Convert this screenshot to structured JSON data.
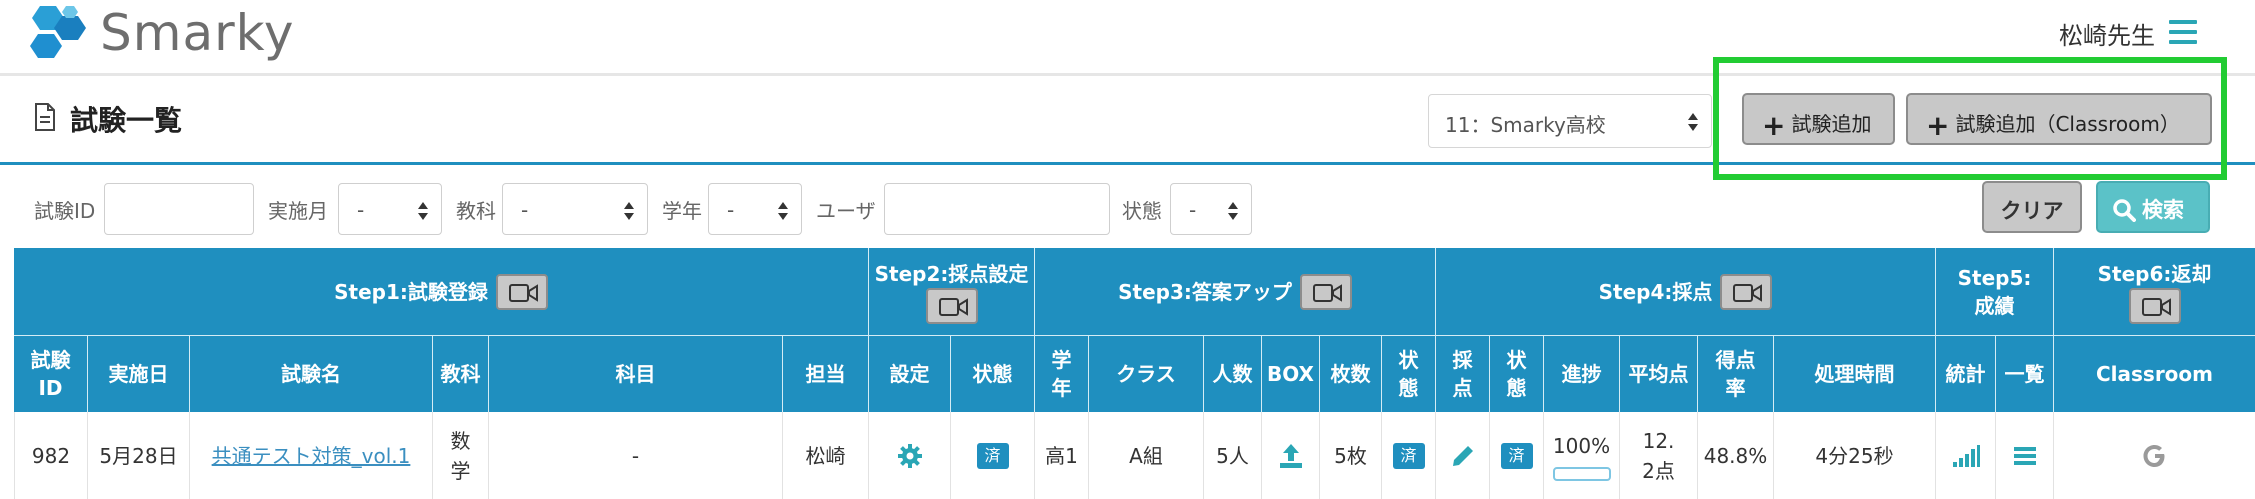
{
  "header": {
    "brand": "Smarky",
    "user": "松崎先生",
    "accent": "#2aa6b5"
  },
  "page": {
    "title": "試験一覧",
    "school_select": "11：Smarky高校",
    "add_exam_label": "試験追加",
    "add_exam_classroom_label": "試験追加（Classroom）",
    "highlight_color": "#22cc33"
  },
  "filters": {
    "exam_id_label": "試験ID",
    "exam_id_value": "",
    "month_label": "実施月",
    "month_value": "-",
    "subject_label": "教科",
    "subject_value": "-",
    "grade_label": "学年",
    "grade_value": "-",
    "user_label": "ユーザ",
    "user_value": "",
    "status_label": "状態",
    "status_value": "-",
    "clear_label": "クリア",
    "search_label": "検索"
  },
  "table": {
    "header_color": "#1f8fbf",
    "steps": {
      "step1": "Step1:試験登録",
      "step2": "Step2:採点設定",
      "step3": "Step3:答案アップ",
      "step4": "Step4:採点",
      "step5": "Step5:成績",
      "step6": "Step6:返却"
    },
    "columns": {
      "exam_id": "試験ID",
      "date": "実施日",
      "exam_name": "試験名",
      "subject": "教科",
      "course": "科目",
      "teacher": "担当",
      "setting": "設定",
      "status2": "状態",
      "grade": "学年",
      "class": "クラス",
      "people": "人数",
      "box": "BOX",
      "sheets": "枚数",
      "status3": "状態",
      "grading": "採点",
      "status4": "状態",
      "progress": "進捗",
      "average": "平均点",
      "score_rate": "得点率",
      "time": "処理時間",
      "stats": "統計",
      "list": "一覧",
      "classroom": "Classroom"
    },
    "row": {
      "exam_id": "982",
      "date": "5月28日",
      "exam_name": "共通テスト対策_vol.1",
      "subject": "数学",
      "course": "-",
      "teacher": "松崎",
      "status2": "済",
      "grade": "高1",
      "class": "A組",
      "people": "5人",
      "sheets": "5枚",
      "status3": "済",
      "status4": "済",
      "progress": "100%",
      "progress_value": 1.0,
      "average": "12.2点",
      "score_rate": "48.8%",
      "time": "4分25秒"
    }
  }
}
